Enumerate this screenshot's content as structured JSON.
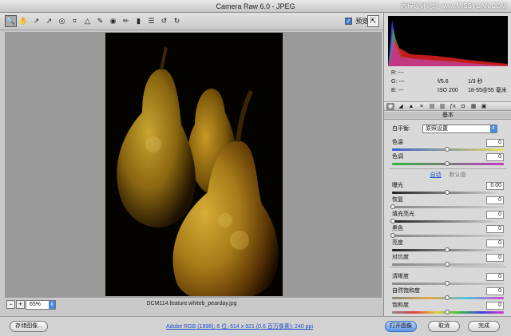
{
  "window": {
    "title": "Camera Raw 6.0 -  JPEG",
    "watermark": "思缘设计论坛 www.MISSYUAN.COM"
  },
  "toolbar": {
    "tools": [
      {
        "name": "zoom-tool",
        "glyph": "🔍"
      },
      {
        "name": "hand-tool",
        "glyph": "✋"
      },
      {
        "name": "white-balance-tool",
        "glyph": "↗"
      },
      {
        "name": "color-sampler-tool",
        "glyph": "↗"
      },
      {
        "name": "target-adjustment-tool",
        "glyph": "◎"
      },
      {
        "name": "crop-tool",
        "glyph": "⌗"
      },
      {
        "name": "straighten-tool",
        "glyph": "△"
      },
      {
        "name": "spot-removal-tool",
        "glyph": "✎"
      },
      {
        "name": "red-eye-tool",
        "glyph": "◉"
      },
      {
        "name": "adjustment-brush-tool",
        "glyph": "✏"
      },
      {
        "name": "graduated-filter-tool",
        "glyph": "▮"
      },
      {
        "name": "preferences-tool",
        "glyph": "☰"
      },
      {
        "name": "rotate-left-tool",
        "glyph": "↺"
      },
      {
        "name": "rotate-right-tool",
        "glyph": "↻"
      }
    ],
    "preview_label": "预览",
    "preview_checked": true
  },
  "zoom": {
    "value": "65%",
    "minus": "-",
    "plus": "+"
  },
  "image": {
    "filename": "DCM114.feature.whiteb_pearday.jpg"
  },
  "readout": {
    "r_label": "R:",
    "g_label": "G:",
    "b_label": "B:",
    "r": "---",
    "g": "---",
    "b": "---",
    "aperture": "f/5.6",
    "shutter": "1/3 秒",
    "iso": "ISO 200",
    "lens": "18-55@55 毫米"
  },
  "panel": {
    "section_title": "基本",
    "white_balance_label": "白平衡:",
    "white_balance_value": "原照设置",
    "auto_label": "自动",
    "default_label": "默认值",
    "sliders": [
      {
        "key": "temperature",
        "label": "色温",
        "value": "0",
        "position": 0.5
      },
      {
        "key": "tint",
        "label": "色调",
        "value": "0",
        "position": 0.5
      },
      {
        "key": "exposure",
        "label": "曝光",
        "value": "0.00",
        "position": 0.5
      },
      {
        "key": "recovery",
        "label": "恢复",
        "value": "0",
        "position": 0.0
      },
      {
        "key": "fill-light",
        "label": "填充亮光",
        "value": "0",
        "position": 0.0
      },
      {
        "key": "blacks",
        "label": "黑色",
        "value": "0",
        "position": 0.0
      },
      {
        "key": "brightness",
        "label": "亮度",
        "value": "0",
        "position": 0.5
      },
      {
        "key": "contrast",
        "label": "对比度",
        "value": "0",
        "position": 0.5
      },
      {
        "key": "clarity",
        "label": "清晰度",
        "value": "0",
        "position": 0.5
      },
      {
        "key": "vibrance",
        "label": "自然饱和度",
        "value": "0",
        "position": 0.5
      },
      {
        "key": "saturation",
        "label": "饱和度",
        "value": "0",
        "position": 0.5
      }
    ]
  },
  "bottom": {
    "save_label": "存储图像...",
    "info_link": "Adobe RGB (1998); 8 位; 614 x 921 (0.6 百万像素); 240 ppi",
    "open_label": "打开图像",
    "cancel_label": "取消",
    "done_label": "完成"
  }
}
